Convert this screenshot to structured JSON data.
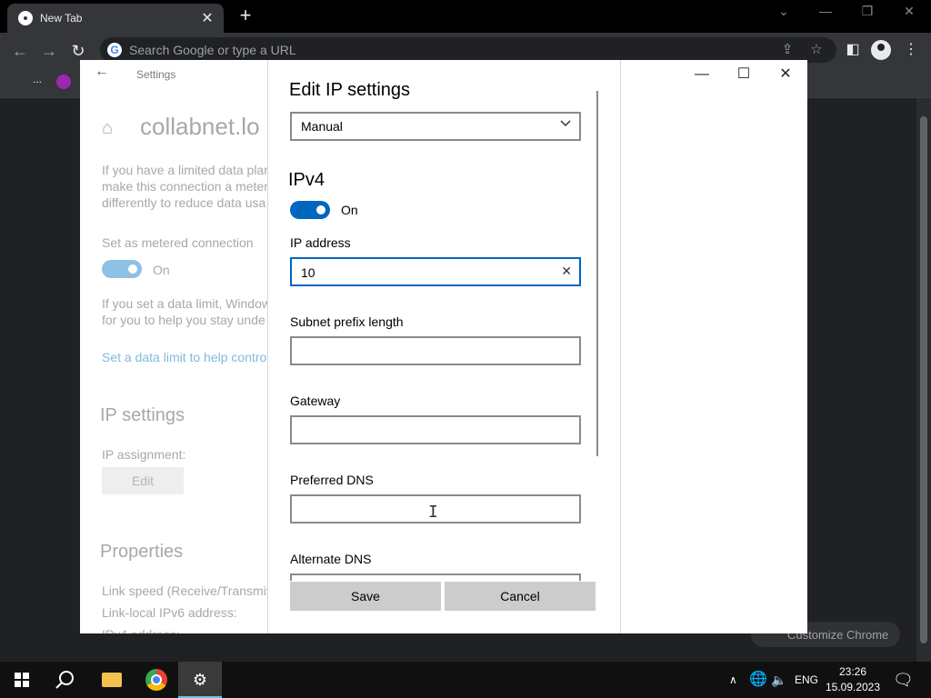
{
  "browser": {
    "tab_title": "New Tab",
    "omnibox_placeholder": "Search Google or type a URL",
    "bookmarks_overflow": "...",
    "customize_label": "Customize Chrome"
  },
  "settings": {
    "window_title": "Settings",
    "network_name": "collabnet.lo",
    "metered_desc_lines": [
      "If you have a limited data plar",
      "make this connection a meter",
      "differently to reduce data usa"
    ],
    "metered_label": "Set as metered connection",
    "metered_state": "On",
    "data_limit_desc_lines": [
      "If you set a data limit, Window",
      "for you to help you stay unde"
    ],
    "data_limit_link": "Set a data limit to help contro",
    "ip_settings_heading": "IP settings",
    "ip_assignment_label": "IP assignment:",
    "edit_button": "Edit",
    "properties_heading": "Properties",
    "link_speed_label": "Link speed (Receive/Transmit)",
    "ipv6_label": "Link-local IPv6 address:",
    "ipv4_label": "IPv4 address:"
  },
  "dialog": {
    "title": "Edit IP settings",
    "mode_selected": "Manual",
    "ipv4_heading": "IPv4",
    "ipv4_toggle_label": "On",
    "fields": {
      "ip_address": {
        "label": "IP address",
        "value": "10"
      },
      "subnet": {
        "label": "Subnet prefix length",
        "value": ""
      },
      "gateway": {
        "label": "Gateway",
        "value": ""
      },
      "preferred_dns": {
        "label": "Preferred DNS",
        "value": ""
      },
      "alternate_dns": {
        "label": "Alternate DNS",
        "value": ""
      }
    },
    "save_label": "Save",
    "cancel_label": "Cancel"
  },
  "taskbar": {
    "language": "ENG",
    "time": "23:26",
    "date": "15.09.2023"
  },
  "colors": {
    "accent": "#0067c0",
    "chrome_dark": "#35363a",
    "taskbar": "#101010"
  },
  "icons": [
    "chrome-icon",
    "close-icon",
    "plus-icon",
    "back-icon",
    "forward-icon",
    "reload-icon",
    "google-icon",
    "share-icon",
    "star-icon",
    "sidepanel-icon",
    "profile-icon",
    "menu-icon",
    "home-icon",
    "chevron-down-icon",
    "clear-icon",
    "windows-start-icon",
    "search-icon",
    "folder-icon",
    "gear-icon",
    "network-icon",
    "volume-icon",
    "notification-icon"
  ]
}
